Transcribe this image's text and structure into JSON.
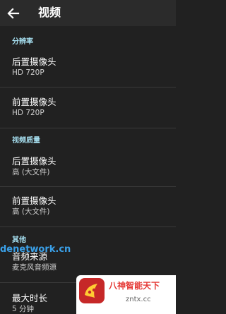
{
  "header": {
    "title": "视频",
    "back_icon": "arrow-back-icon"
  },
  "sections": {
    "resolution": {
      "label": "分辨率"
    },
    "quality": {
      "label": "视频质量"
    },
    "other": {
      "label": "其他"
    }
  },
  "items": {
    "res_rear": {
      "title": "后置摄像头",
      "value": "HD 720P"
    },
    "res_front": {
      "title": "前置摄像头",
      "value": "HD 720P"
    },
    "qual_rear": {
      "title": "后置摄像头",
      "value": "高 (大文件)"
    },
    "qual_front": {
      "title": "前置摄像头",
      "value": "高 (大文件)"
    },
    "audio_source": {
      "title": "音频来源",
      "value": "麦克风音频源"
    },
    "max_duration": {
      "title": "最大时长",
      "value": "5 分钟"
    }
  },
  "watermarks": {
    "left_text": "denetwork.cn",
    "logo_cn": "八神智能天下",
    "logo_url": "zntx.cc"
  },
  "colors": {
    "background": "#212121",
    "toolbar": "#2b2b2b",
    "section_header": "#a6dff0",
    "title_text": "#ffffff",
    "subtitle_text": "#cfcfcf"
  }
}
